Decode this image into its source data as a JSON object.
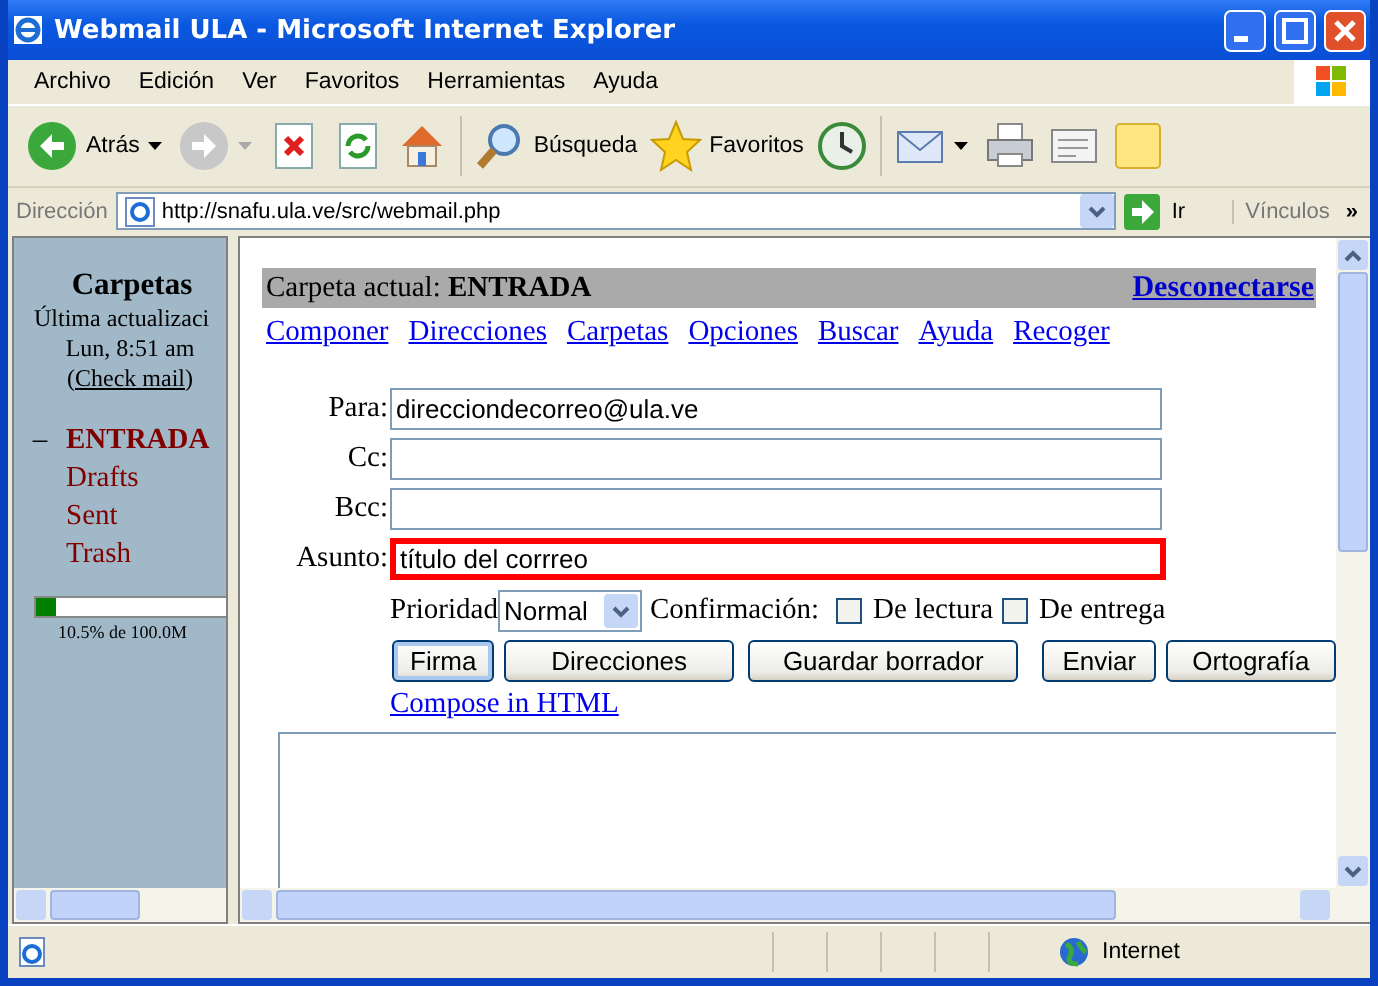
{
  "window": {
    "title": "Webmail ULA - Microsoft Internet Explorer"
  },
  "menu": [
    "Archivo",
    "Edición",
    "Ver",
    "Favoritos",
    "Herramientas",
    "Ayuda"
  ],
  "toolbar": [
    {
      "kind": "back",
      "label": "Atrás"
    },
    {
      "kind": "forward"
    },
    {
      "kind": "stop"
    },
    {
      "kind": "refresh"
    },
    {
      "kind": "home"
    },
    {
      "kind": "search",
      "label": "Búsqueda"
    },
    {
      "kind": "favorites",
      "label": "Favoritos"
    },
    {
      "kind": "history"
    },
    {
      "kind": "mail"
    },
    {
      "kind": "print"
    },
    {
      "kind": "edit"
    },
    {
      "kind": "note"
    }
  ],
  "address_bar": {
    "label": "Dirección",
    "url": "http://snafu.ula.ve/src/webmail.php",
    "go": "Ir",
    "links": "Vínculos",
    "more": "»"
  },
  "sidebar": {
    "title": "Carpetas",
    "updated_label": "Última actualizaci",
    "updated_time": "Lun, 8:51 am",
    "check_open": "(",
    "check_mail": "Check mail",
    "check_close": ")",
    "folders": [
      {
        "name": "ENTRADA",
        "selected": true,
        "toggle": "–"
      },
      {
        "name": "Drafts",
        "selected": false
      },
      {
        "name": "Sent",
        "selected": false
      },
      {
        "name": "Trash",
        "selected": false
      }
    ],
    "quota": {
      "level": 0.105,
      "reading": "10.5% de 100.0M"
    }
  },
  "header": {
    "text": "Carpeta actual: **ENTRADA**",
    "logout": "Desconectarse"
  },
  "nav": [
    "Componer",
    "Direcciones",
    "Carpetas",
    "Opciones",
    "Buscar",
    "Ayuda",
    "Recoger"
  ],
  "fields": [
    {
      "label": "Para:",
      "value": "direcciondecorreo@ula.ve",
      "highlighted": false
    },
    {
      "label": "Cc:",
      "highlighted": false
    },
    {
      "label": "Bcc:",
      "highlighted": false
    },
    {
      "label": "Asunto:",
      "value": "título del corrreo",
      "highlighted": true
    }
  ],
  "options": {
    "priority_label": "Prioridad",
    "priority": "Normal",
    "confirm_label": "Confirmación:",
    "checks": [
      {
        "label": "De lectura",
        "checked": false
      },
      {
        "label": "De entrega",
        "checked": false
      }
    ]
  },
  "buttons": [
    {
      "label": "Firma",
      "selected": true
    },
    {
      "label": "Direcciones",
      "selected": false
    },
    {
      "label": "Guardar borrador",
      "selected": false
    },
    {
      "label": "Enviar",
      "selected": false
    },
    {
      "label": "Ortografía",
      "selected": false
    }
  ],
  "compose_html": "Compose in HTML",
  "status_bar": {
    "zone": "Internet"
  }
}
